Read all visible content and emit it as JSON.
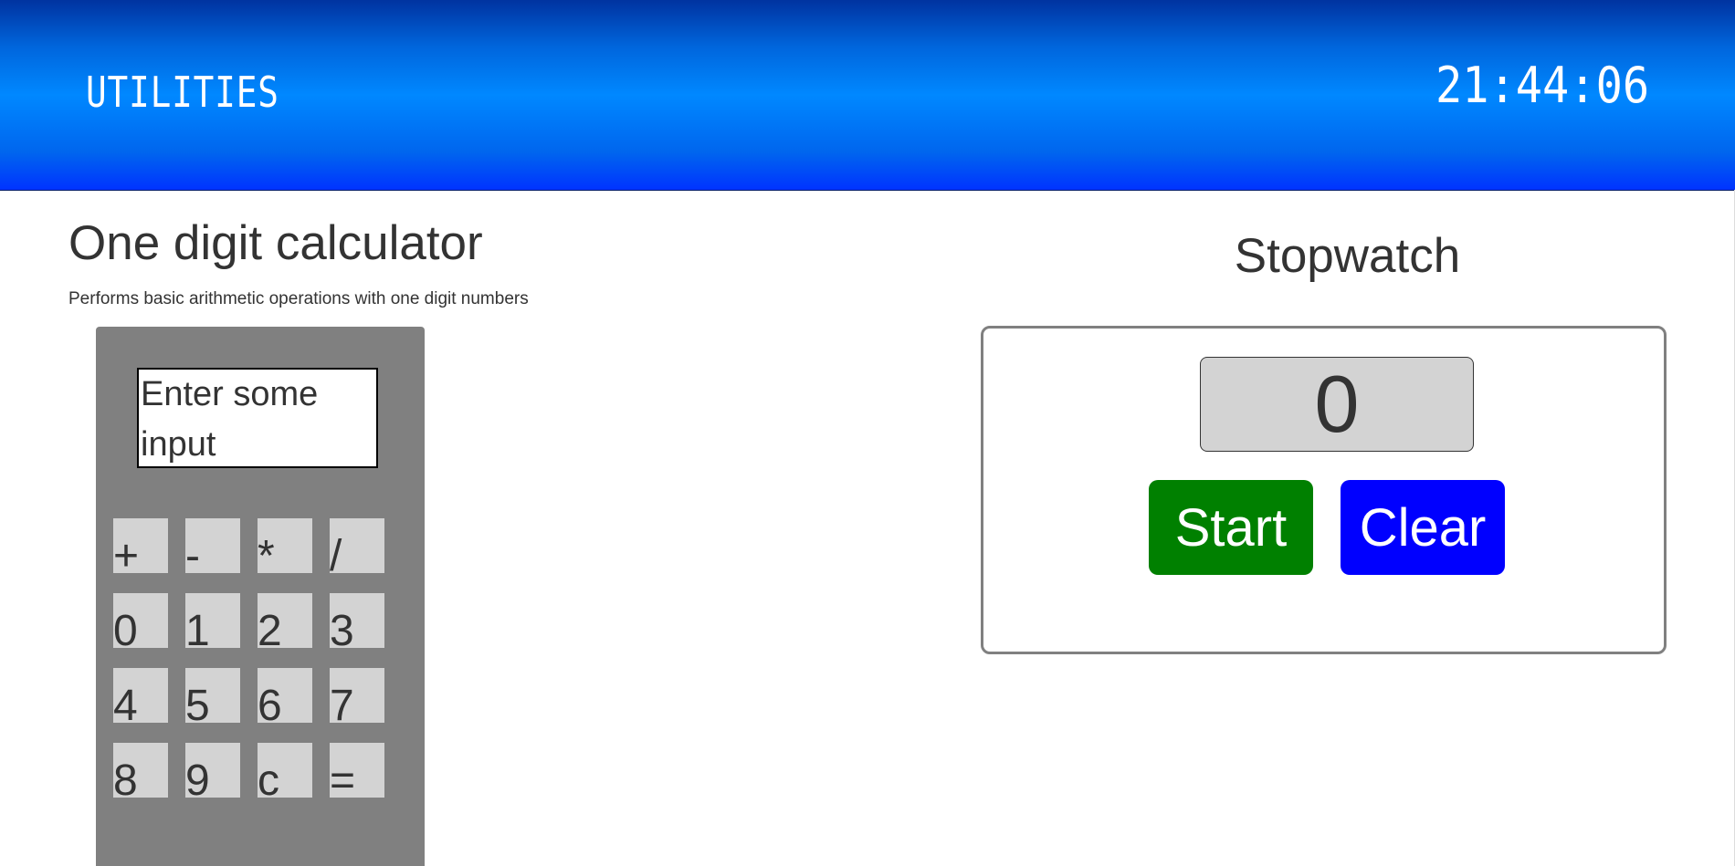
{
  "header": {
    "title": "UTILITIES",
    "clock": "21:44:06"
  },
  "calculator": {
    "title": "One digit calculator",
    "description": "Performs basic arithmetic operations with one digit numbers",
    "display_placeholder": "Enter some input",
    "keys": [
      "+",
      "-",
      "*",
      "/",
      "0",
      "1",
      "2",
      "3",
      "4",
      "5",
      "6",
      "7",
      "8",
      "9",
      "c",
      "="
    ]
  },
  "stopwatch": {
    "title": "Stopwatch",
    "value": "0",
    "start_label": "Start",
    "clear_label": "Clear"
  },
  "colors": {
    "header_gradient_top": "#0033a0",
    "header_gradient_mid": "#0088ff",
    "calculator_body": "#808080",
    "key_bg": "#d3d3d3",
    "start_button": "#008000",
    "clear_button": "#0000ff"
  }
}
